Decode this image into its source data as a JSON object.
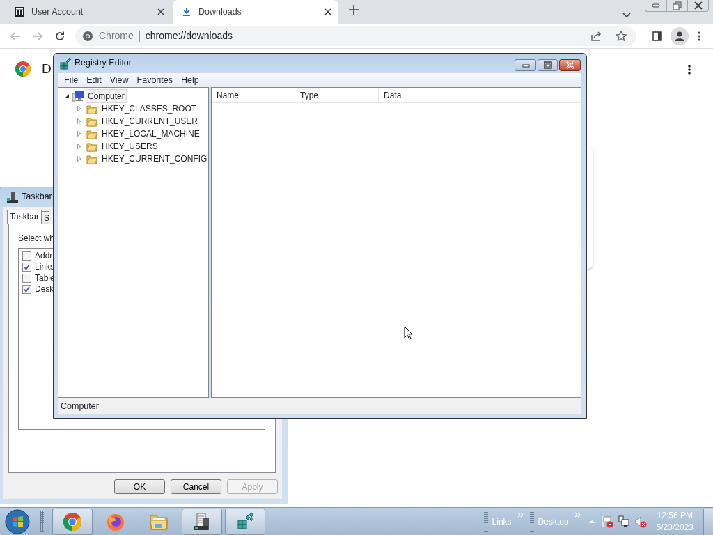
{
  "browser": {
    "tabs": [
      {
        "label": "User Account",
        "selected": false
      },
      {
        "label": "Downloads",
        "selected": true
      }
    ],
    "address": {
      "origin": "Chrome",
      "url": "chrome://downloads"
    },
    "page": {
      "heading": "D"
    }
  },
  "taskbar_properties": {
    "title": "Taskbar",
    "tabs": [
      {
        "label": "Taskbar",
        "selected": true
      },
      {
        "label": "S",
        "selected": false
      }
    ],
    "instruction": "Select wh",
    "toolbars": [
      {
        "label": "Addr",
        "checked": false
      },
      {
        "label": "Links",
        "checked": true
      },
      {
        "label": "Table",
        "checked": false
      },
      {
        "label": "Desk",
        "checked": true
      }
    ],
    "buttons": [
      {
        "label": "OK",
        "disabled": false
      },
      {
        "label": "Cancel",
        "disabled": false
      },
      {
        "label": "Apply",
        "disabled": true
      }
    ]
  },
  "registry_editor": {
    "title": "Registry Editor",
    "menu": [
      "File",
      "Edit",
      "View",
      "Favorites",
      "Help"
    ],
    "tree": {
      "label": "Computer",
      "expanded": true,
      "selected": true,
      "children": [
        {
          "label": "HKEY_CLASSES_ROOT",
          "expanded": false
        },
        {
          "label": "HKEY_CURRENT_USER",
          "expanded": false
        },
        {
          "label": "HKEY_LOCAL_MACHINE",
          "expanded": false
        },
        {
          "label": "HKEY_USERS",
          "expanded": false
        },
        {
          "label": "HKEY_CURRENT_CONFIG",
          "expanded": false
        }
      ]
    },
    "columns": [
      "Name",
      "Type",
      "Data"
    ],
    "status_bar": "Computer"
  },
  "taskbar": {
    "apps": [
      {
        "kind": "chrome",
        "running": true
      },
      {
        "kind": "firefox",
        "running": false
      },
      {
        "kind": "explorer",
        "running": false
      },
      {
        "kind": "server",
        "running": true
      },
      {
        "kind": "registry",
        "running": true
      }
    ],
    "toolbars": [
      "Links",
      "Desktop"
    ],
    "clock": {
      "time": "12:56 PM",
      "date": "5/23/2023"
    }
  }
}
